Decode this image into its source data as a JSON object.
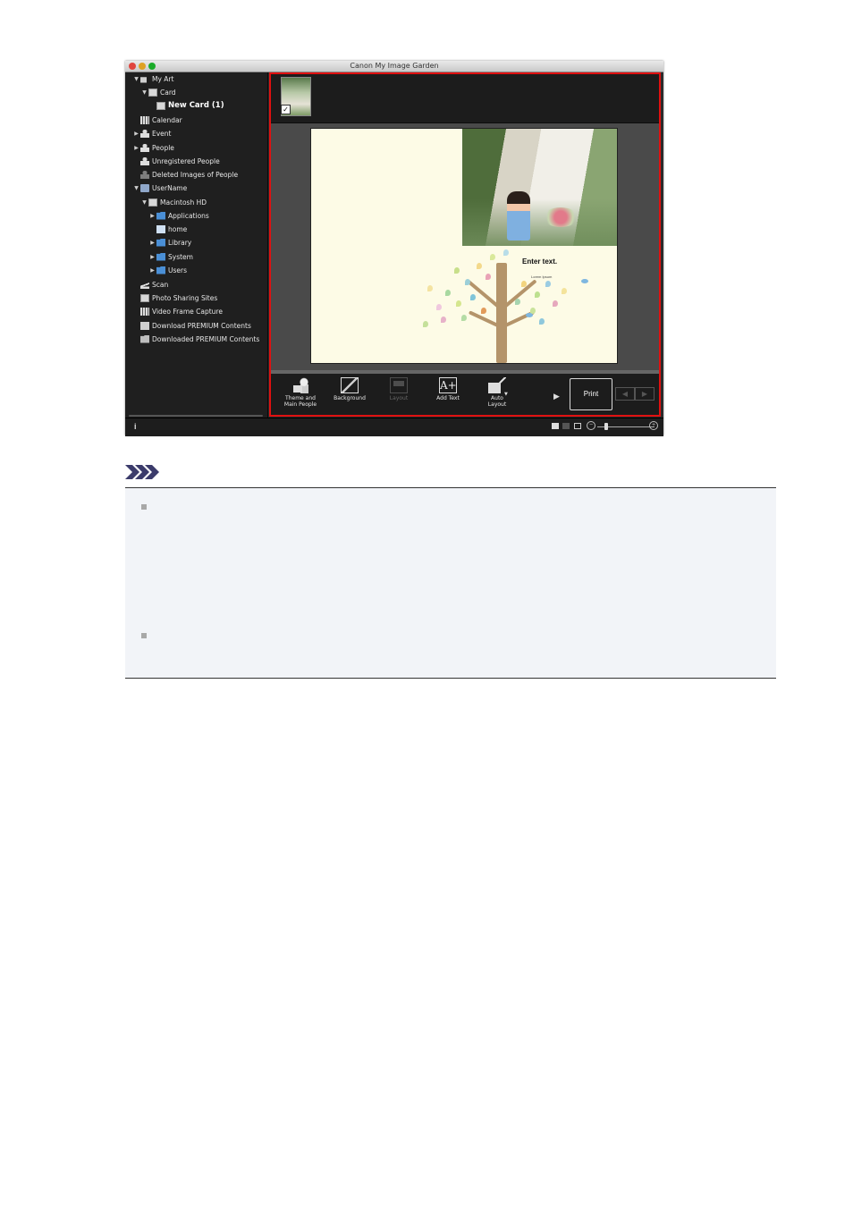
{
  "window": {
    "title": "Canon My Image Garden"
  },
  "sidebar": {
    "items": [
      {
        "label": "My Art",
        "icon": "my-art-icon"
      },
      {
        "label": "Card",
        "icon": "card-icon"
      },
      {
        "label": "New Card (1)",
        "icon": "card-icon"
      },
      {
        "label": "Calendar",
        "icon": "calendar-icon"
      },
      {
        "label": "Event",
        "icon": "event-icon"
      },
      {
        "label": "People",
        "icon": "people-icon"
      },
      {
        "label": "Unregistered People",
        "icon": "unregistered-people-icon"
      },
      {
        "label": "Deleted Images of People",
        "icon": "deleted-people-icon"
      },
      {
        "label": "UserName",
        "icon": "computer-icon"
      },
      {
        "label": "Macintosh HD",
        "icon": "hard-disk-icon"
      },
      {
        "label": "Applications",
        "icon": "folder-icon"
      },
      {
        "label": "home",
        "icon": "home-folder-icon"
      },
      {
        "label": "Library",
        "icon": "folder-icon"
      },
      {
        "label": "System",
        "icon": "folder-icon"
      },
      {
        "label": "Users",
        "icon": "folder-icon"
      },
      {
        "label": "Scan",
        "icon": "scan-icon"
      },
      {
        "label": "Photo Sharing Sites",
        "icon": "photo-sharing-icon"
      },
      {
        "label": "Video Frame Capture",
        "icon": "video-frame-icon"
      },
      {
        "label": "Download PREMIUM Contents",
        "icon": "download-icon"
      },
      {
        "label": "Downloaded PREMIUM Contents",
        "icon": "downloaded-folder-icon"
      }
    ],
    "selected": "New Card (1)"
  },
  "canvas": {
    "text_placeholder": "Enter text.",
    "text_small": "Lorem Ipsum"
  },
  "toolbar": {
    "theme_label_1": "Theme and",
    "theme_label_2": "Main People",
    "background_label": "Background",
    "layout_label": "Layout",
    "add_text_label": "Add Text",
    "auto_layout_label_1": "Auto",
    "auto_layout_label_2": "Layout",
    "print_label": "Print"
  },
  "colors": {
    "highlight_border": "#e01010",
    "page_background": "#fdfbe6",
    "app_dark": "#1c1c1c"
  }
}
